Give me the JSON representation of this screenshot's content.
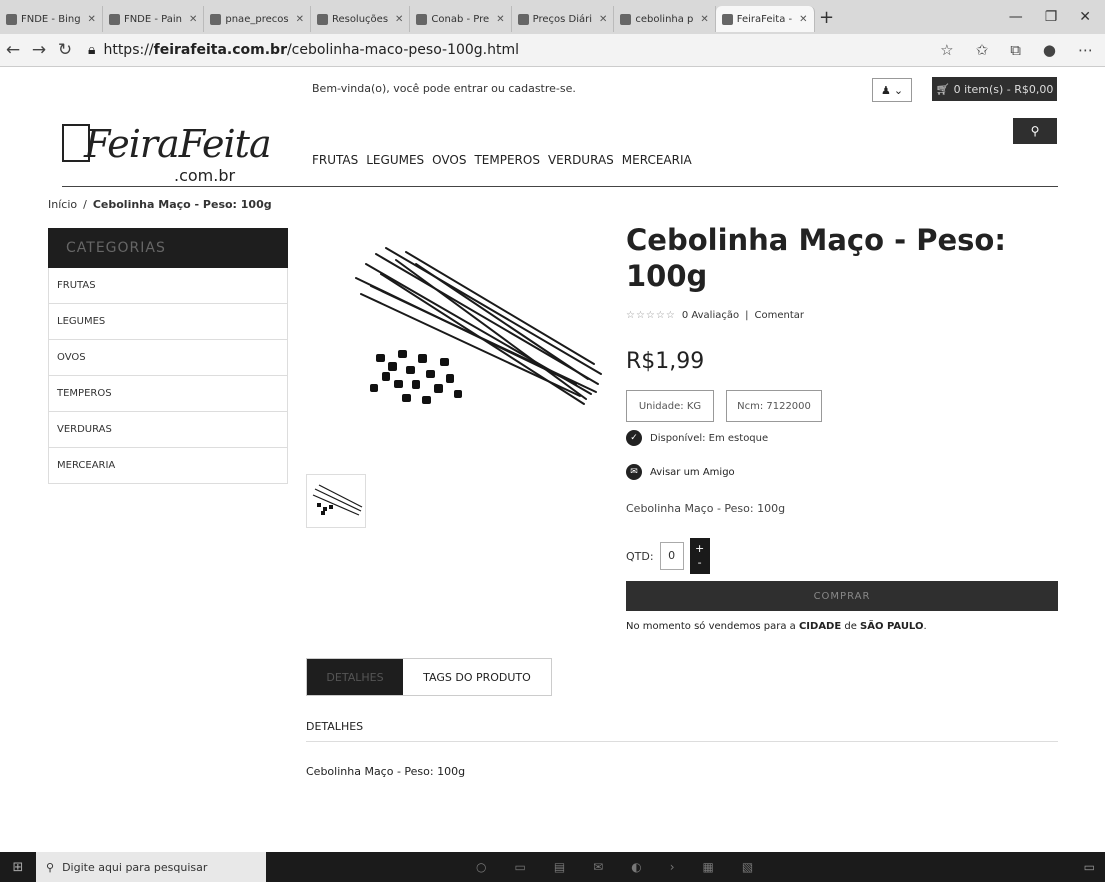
{
  "browser": {
    "tabs": [
      {
        "label": "FNDE - Bing"
      },
      {
        "label": "FNDE - Pain"
      },
      {
        "label": "pnae_precos"
      },
      {
        "label": "Resoluções"
      },
      {
        "label": "Conab - Pre"
      },
      {
        "label": "Preços Diári"
      },
      {
        "label": "cebolinha p"
      },
      {
        "label": "FeiraFeita -"
      }
    ],
    "url_prefix": "https://",
    "url_domain": "feirafeita.com.br",
    "url_path": "/cebolinha-maco-peso-100g.html"
  },
  "header": {
    "welcome": "Bem-vinda(o), você pode entrar ou cadastre-se.",
    "cart_label": "0 item(s) - R$0,00",
    "logo_text": "FeiraFeita",
    "logo_domain": ".com.br",
    "menu": [
      "FRUTAS",
      "LEGUMES",
      "OVOS",
      "TEMPEROS",
      "VERDURAS",
      "MERCEARIA"
    ]
  },
  "breadcrumb": {
    "home": "Início",
    "separator": "/",
    "current": "Cebolinha Maço - Peso: 100g"
  },
  "sidebar": {
    "title": "CATEGORIAS",
    "items": [
      "FRUTAS",
      "LEGUMES",
      "OVOS",
      "TEMPEROS",
      "VERDURAS",
      "MERCEARIA"
    ]
  },
  "product": {
    "title": "Cebolinha Maço - Peso: 100g",
    "rating_text": "0 Avaliação",
    "comment_link": "Comentar",
    "price": "R$1,99",
    "unit": "Unidade: KG",
    "ncm": "Ncm: 7122000",
    "availability": "Disponível: Em estoque",
    "tell_friend": "Avisar um Amigo",
    "short_name": "Cebolinha Maço - Peso: 100g",
    "qty_label": "QTD:",
    "qty_value": "0",
    "buy_label": "COMPRAR",
    "notice_prefix": "No momento só vendemos para a ",
    "notice_city": "CIDADE",
    "notice_mid": " de ",
    "notice_state": "SÃO PAULO",
    "notice_end": "."
  },
  "tabs": {
    "active": "DETALHES",
    "other": "TAGS DO PRODUTO"
  },
  "details": {
    "heading": "DETALHES",
    "text": "Cebolinha Maço - Peso: 100g"
  },
  "taskbar": {
    "search_placeholder": "Digite aqui para pesquisar"
  },
  "colors": {
    "dark": "#2f2f2f",
    "black": "#1e1e1e"
  }
}
